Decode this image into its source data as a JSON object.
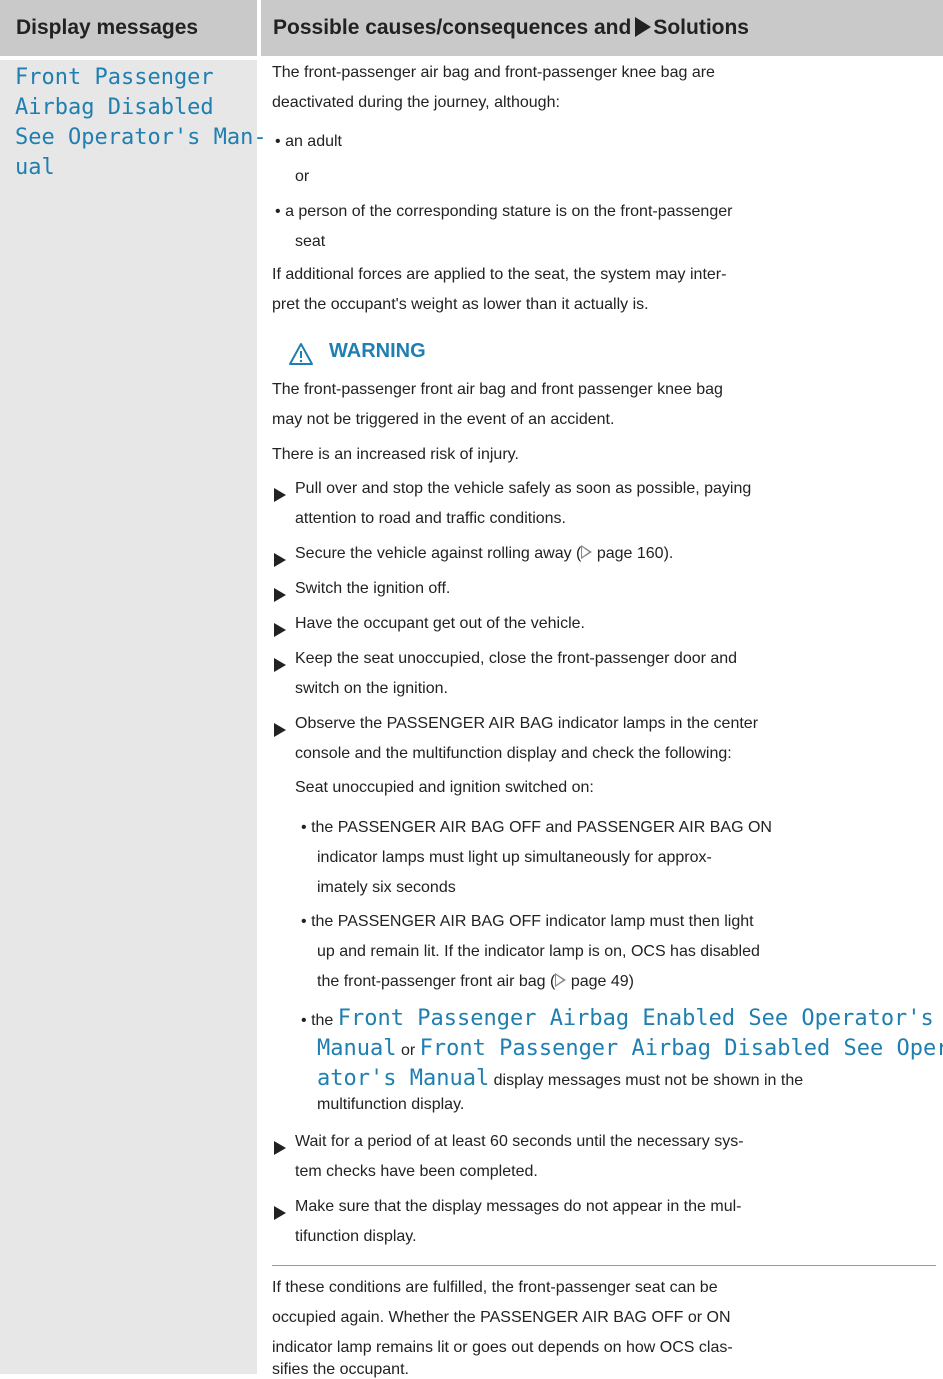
{
  "header": {
    "col1": "Display messages",
    "col2_part1": "Possible causes/consequences and",
    "col2_part2": "Solutions"
  },
  "display_message": {
    "lines": [
      "Front Passenger",
      "Airbag Disabled",
      "See Operator's Man-",
      "ual"
    ]
  },
  "body": {
    "intro_l1": "The front-passenger air bag and front-passenger knee bag are",
    "intro_l2": "deactivated during the journey, although:",
    "b1": "an adult",
    "or": "or",
    "b2_l1": "a person of the corresponding stature is on the front-passenger",
    "b2_l2": "seat",
    "p2_l1": "If additional forces are applied to the seat, the system may inter-",
    "p2_l2": "pret the occupant's weight as lower than it actually is.",
    "warning_title": "WARNING",
    "w1_l1": "The front-passenger front air bag and front passenger knee bag",
    "w1_l2": "may not be triggered in the event of an accident.",
    "w2": "There is an increased risk of injury.",
    "s1_l1": "Pull over and stop the vehicle safely as soon as possible, paying",
    "s1_l2": "attention to road and traffic conditions.",
    "s2_pre": "Secure the vehicle against rolling away (",
    "s2_page": "page 160).",
    "s3": "Switch the ignition off.",
    "s4": "Have the occupant get out of the vehicle.",
    "s5_l1": "Keep the seat unoccupied, close the front-passenger door and",
    "s5_l2": "switch on the ignition.",
    "s6_l1": "Observe the PASSENGER AIR BAG indicator lamps in the center",
    "s6_l2": "console and the multifunction display and check the following:",
    "s6_l3": "Seat unoccupied and ignition switched on:",
    "sb1_l1": "the PASSENGER AIR BAG OFF and PASSENGER AIR BAG ON",
    "sb1_l2": "indicator lamps must light up simultaneously for approx-",
    "sb1_l3": "imately six seconds",
    "sb2_l1": "the PASSENGER AIR BAG OFF indicator lamp must then light",
    "sb2_l2": "up and remain lit. If the indicator lamp is on, OCS has disabled",
    "sb2_l3_pre": "the front-passenger front air bag (",
    "sb2_l3_page": "page 49)",
    "sb3_the": "the",
    "sb3_msg1_a": "Front Passenger Airbag Enabled See Operator's",
    "sb3_msg1_b": "Manual",
    "sb3_or": "or",
    "sb3_msg2_a": "Front Passenger Airbag Disabled See Oper-",
    "sb3_msg2_b": "ator's Manual",
    "sb3_rest_l2": "display messages must not be shown in the",
    "sb3_rest_l3": "multifunction display.",
    "s7_l1": "Wait for a period of at least 60 seconds until the necessary sys-",
    "s7_l2": "tem checks have been completed.",
    "s8_l1": "Make sure that the display messages do not appear in the mul-",
    "s8_l2": "tifunction display.",
    "p3_l1": "If these conditions are fulfilled, the front-passenger seat can be",
    "p3_l2": "occupied again. Whether the PASSENGER AIR BAG OFF or ON",
    "p3_l3": "indicator lamp remains lit or goes out depends on how OCS clas-",
    "p3_l4": "sifies the occupant."
  }
}
